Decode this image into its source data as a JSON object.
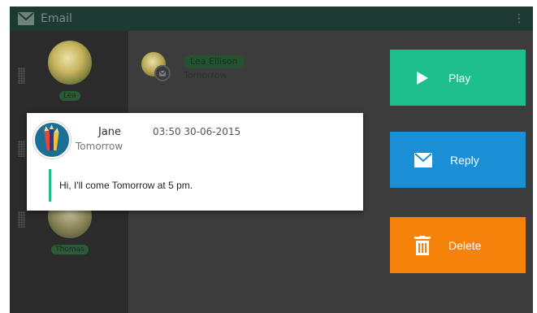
{
  "appbar": {
    "title": "Email",
    "more": "⋮",
    "accent": "#1f3a33"
  },
  "sidebar": {
    "contacts": [
      {
        "name": "Lea"
      },
      {
        "name": ""
      },
      {
        "name": "Thomas"
      }
    ]
  },
  "list": {
    "badge": "Lea Ellison",
    "subtitle": "Tomorrow"
  },
  "actions": {
    "play": {
      "label": "Play",
      "color": "#1dbf8c"
    },
    "reply": {
      "label": "Reply",
      "color": "#1b8fd6"
    },
    "delete": {
      "label": "Delete",
      "color": "#f5820b"
    }
  },
  "card": {
    "name": "Jane",
    "datetime": "03:50  30-06-2015",
    "subtitle": "Tomorrow",
    "message": "Hi, I'll come Tomorrow at 5 pm."
  }
}
